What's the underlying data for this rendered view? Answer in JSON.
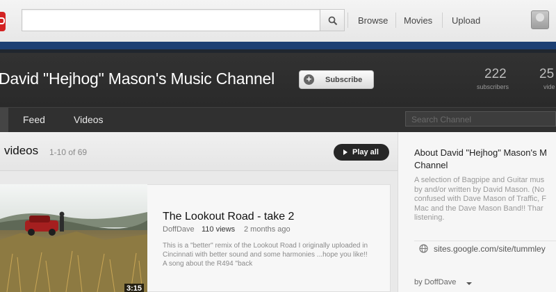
{
  "topbar": {
    "search": {
      "value": "",
      "placeholder": ""
    },
    "nav": [
      "Browse",
      "Movies",
      "Upload"
    ]
  },
  "channel": {
    "title": "David \"Hejhog\" Mason's Music Channel",
    "subscribe_label": "Subscribe",
    "stats": [
      {
        "value": "222",
        "label": "subscribers"
      },
      {
        "value": "25",
        "label": "vide"
      }
    ],
    "tabs": [
      "Feed",
      "Videos"
    ],
    "search_placeholder": "Search Channel"
  },
  "videos": {
    "heading": "videos",
    "count": "1-10 of 69",
    "play_all_label": "Play all",
    "items": [
      {
        "title": "The Lookout Road - take 2",
        "author": "DoffDave",
        "views": "110 views",
        "age": "2 months ago",
        "description": "This is a \"better\" remix of the Lookout Road I originally uploaded in Cincinnati with better sound and some harmonies ...hope you like!! A song about the R494 \"back",
        "duration": "3:15"
      }
    ]
  },
  "about": {
    "title_lines": [
      "About David \"Hejhog\" Mason's M",
      "Channel"
    ],
    "text_lines": [
      "A selection of Bagpipe and Guitar mus",
      "by and/or written by David Mason. (No",
      "confused with Dave Mason of Traffic, F",
      "Mac and the Dave Mason Band!! Thar",
      "listening."
    ],
    "link": "sites.google.com/site/tummley",
    "by": "by DoffDave"
  },
  "colors": {
    "brand": "#d32222",
    "header_strip": "#1c3f73",
    "channel_bg": "#2f2f2f"
  }
}
